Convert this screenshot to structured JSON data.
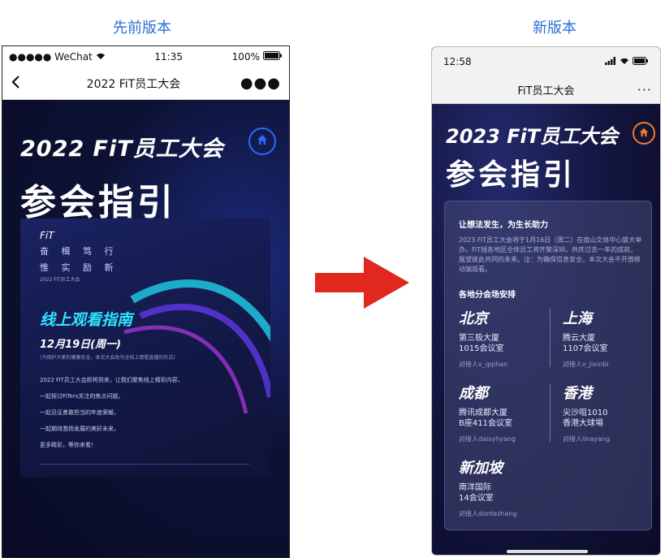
{
  "captions": {
    "left": "先前版本",
    "right": "新版本"
  },
  "old_phone": {
    "status": {
      "carrier": "●●●●● WeChat",
      "time": "11:35",
      "battery": "100%"
    },
    "nav_title": "2022 FiT员工大会",
    "title_line1": "2022 FiT员工大会",
    "title_line2": "参会指引",
    "card": {
      "logo": "FiT",
      "slogan1": "奋 楫 笃 行",
      "slogan2": "惟 实 励 新",
      "small": "2022 FiT员工大会",
      "guide": "线上观看指南",
      "date": "12月19日(周一)",
      "note": "(为保护大家的健康安全，本次大会改为全线上观看直播的形式)",
      "lines": [
        "2022 FiT员工大会即将到来，让我们聚焦线上精彩内容，",
        "一起探讨FiTers关注的焦点问题，",
        "一起见证勇敢担当的年度荣耀，",
        "一起期待激扬发展的美好未来。",
        "更多精彩，等你来看！"
      ]
    }
  },
  "new_phone": {
    "status": {
      "time": "12:58"
    },
    "nav_title": "FiT员工大会",
    "title_line1": "2023 FiT员工大会",
    "title_line2": "参会指引",
    "card": {
      "heading": "让想法发生，为生长助力",
      "intro": "2023 FiT员工大会将于1月16日（周二）在南山文体中心盛大举办。FiT线各地区全体员工将齐聚深圳，共庆过去一年的成就，展望彼此共同的未来。注：为确保信息安全，本次大会不开放移动端观看。",
      "sub_heading": "各地分会场安排",
      "cities": [
        {
          "name": "北京",
          "addr1": "第三极大厦",
          "addr2": "1015会议室",
          "contact": "对接人v_qqihan"
        },
        {
          "name": "上海",
          "addr1": "腾云大厦",
          "addr2": "1107会议室",
          "contact": "对接人v_jixinbi"
        },
        {
          "name": "成都",
          "addr1": "腾讯成都大厦",
          "addr2": "B座411会议室",
          "contact": "对接人daisyhyang"
        },
        {
          "name": "香港",
          "addr1": "尖沙咀1010",
          "addr2": "香港大球場",
          "contact": "对接人linayang"
        },
        {
          "name": "新加坡",
          "addr1": "南洋国际",
          "addr2": "14会议室",
          "contact": "对接人dontezhang"
        }
      ]
    }
  },
  "colors": {
    "caption": "#2b6fd6",
    "arrow": "#e0281e",
    "old_home_ring": "#2a6aff",
    "new_home_ring": "#f07a2a",
    "guide_cyan": "#2ee6ff"
  }
}
